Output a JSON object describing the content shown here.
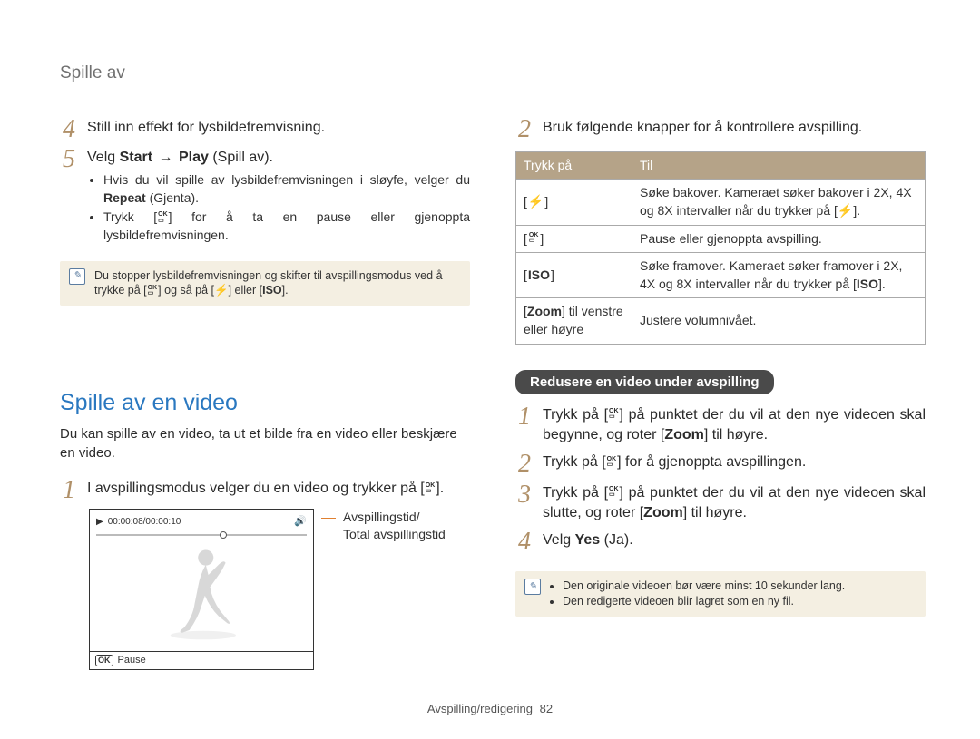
{
  "header": {
    "title": "Spille av"
  },
  "left": {
    "steps": [
      {
        "num": "4",
        "text": "Still inn effekt for lysbildefremvisning."
      },
      {
        "num": "5",
        "text_prefix": "Velg ",
        "text_b1": "Start",
        "text_arrow": "→",
        "text_b2": "Play",
        "text_suffix": " (Spill av).",
        "bullets": [
          {
            "pre": "Hvis du vil spille av lysbildefremvisningen i sløyfe, velger du ",
            "b": "Repeat",
            "post": " (Gjenta)."
          },
          {
            "pre": "Trykk [",
            "icon": "ok",
            "post": "] for å ta en pause eller gjenoppta lysbildefremvisningen."
          }
        ]
      }
    ],
    "note": "Du stopper lysbildefremvisningen og skifter til avspillingsmodus ved å trykke på [",
    "note_mid": "] og så på [",
    "note_flash": "⚡",
    "note_or": "] eller [",
    "note_iso": "ISO",
    "note_end": "].",
    "section_title": "Spille av en video",
    "section_desc": "Du kan spille av en video, ta ut et bilde fra en video eller beskjære en video.",
    "video_step": {
      "num": "1",
      "text_pre": "I avspillingsmodus velger du en video og trykker på [",
      "text_post": "]."
    },
    "video": {
      "time": "00:00:08/00:00:10",
      "pause_label": "Pause"
    },
    "callout": {
      "line1": "Avspillingstid/",
      "line2": "Total avspillingstid"
    }
  },
  "right": {
    "intro_step": {
      "num": "2",
      "text": "Bruk følgende knapper for å kontrollere avspilling."
    },
    "table": {
      "headers": [
        "Trykk på",
        "Til"
      ],
      "rows": [
        {
          "icon": "flash",
          "desc_pre": "Søke bakover. Kameraet søker bakover i 2X, 4X og 8X intervaller når du trykker på [",
          "desc_icon": "⚡",
          "desc_post": "]."
        },
        {
          "icon": "ok",
          "desc_pre": "Pause eller gjenoppta avspilling.",
          "desc_icon": "",
          "desc_post": ""
        },
        {
          "icon": "iso",
          "desc_pre": "Søke framover. Kameraet søker framover i 2X, 4X og 8X intervaller når du trykker på [",
          "desc_icon": "ISO",
          "desc_post": "]."
        },
        {
          "icon": "zoom",
          "icon_text_pre": "[",
          "icon_text_b": "Zoom",
          "icon_text_post": "] til venstre eller høyre",
          "desc_pre": "Justere volumnivået.",
          "desc_icon": "",
          "desc_post": ""
        }
      ]
    },
    "pill": "Redusere en video under avspilling",
    "reduce_steps": [
      {
        "num": "1",
        "pre": "Trykk på [",
        "icon": "ok",
        "mid1": "] på punktet der du vil at den nye videoen skal begynne, og roter [",
        "b": "Zoom",
        "mid2": "] til høyre."
      },
      {
        "num": "2",
        "pre": "Trykk på [",
        "icon": "ok",
        "mid1": "] for å gjenoppta avspillingen.",
        "b": "",
        "mid2": ""
      },
      {
        "num": "3",
        "pre": "Trykk på [",
        "icon": "ok",
        "mid1": "] på punktet der du vil at den nye videoen skal slutte, og roter [",
        "b": "Zoom",
        "mid2": "] til høyre."
      },
      {
        "num": "4",
        "pre": "Velg ",
        "icon": "",
        "mid1": "",
        "b": "Yes",
        "mid2": " (Ja)."
      }
    ],
    "note": {
      "items": [
        "Den originale videoen bør være minst 10 sekunder lang.",
        "Den redigerte videoen blir lagret som en ny fil."
      ]
    }
  },
  "footer": {
    "section": "Avspilling/redigering",
    "page": "82"
  }
}
